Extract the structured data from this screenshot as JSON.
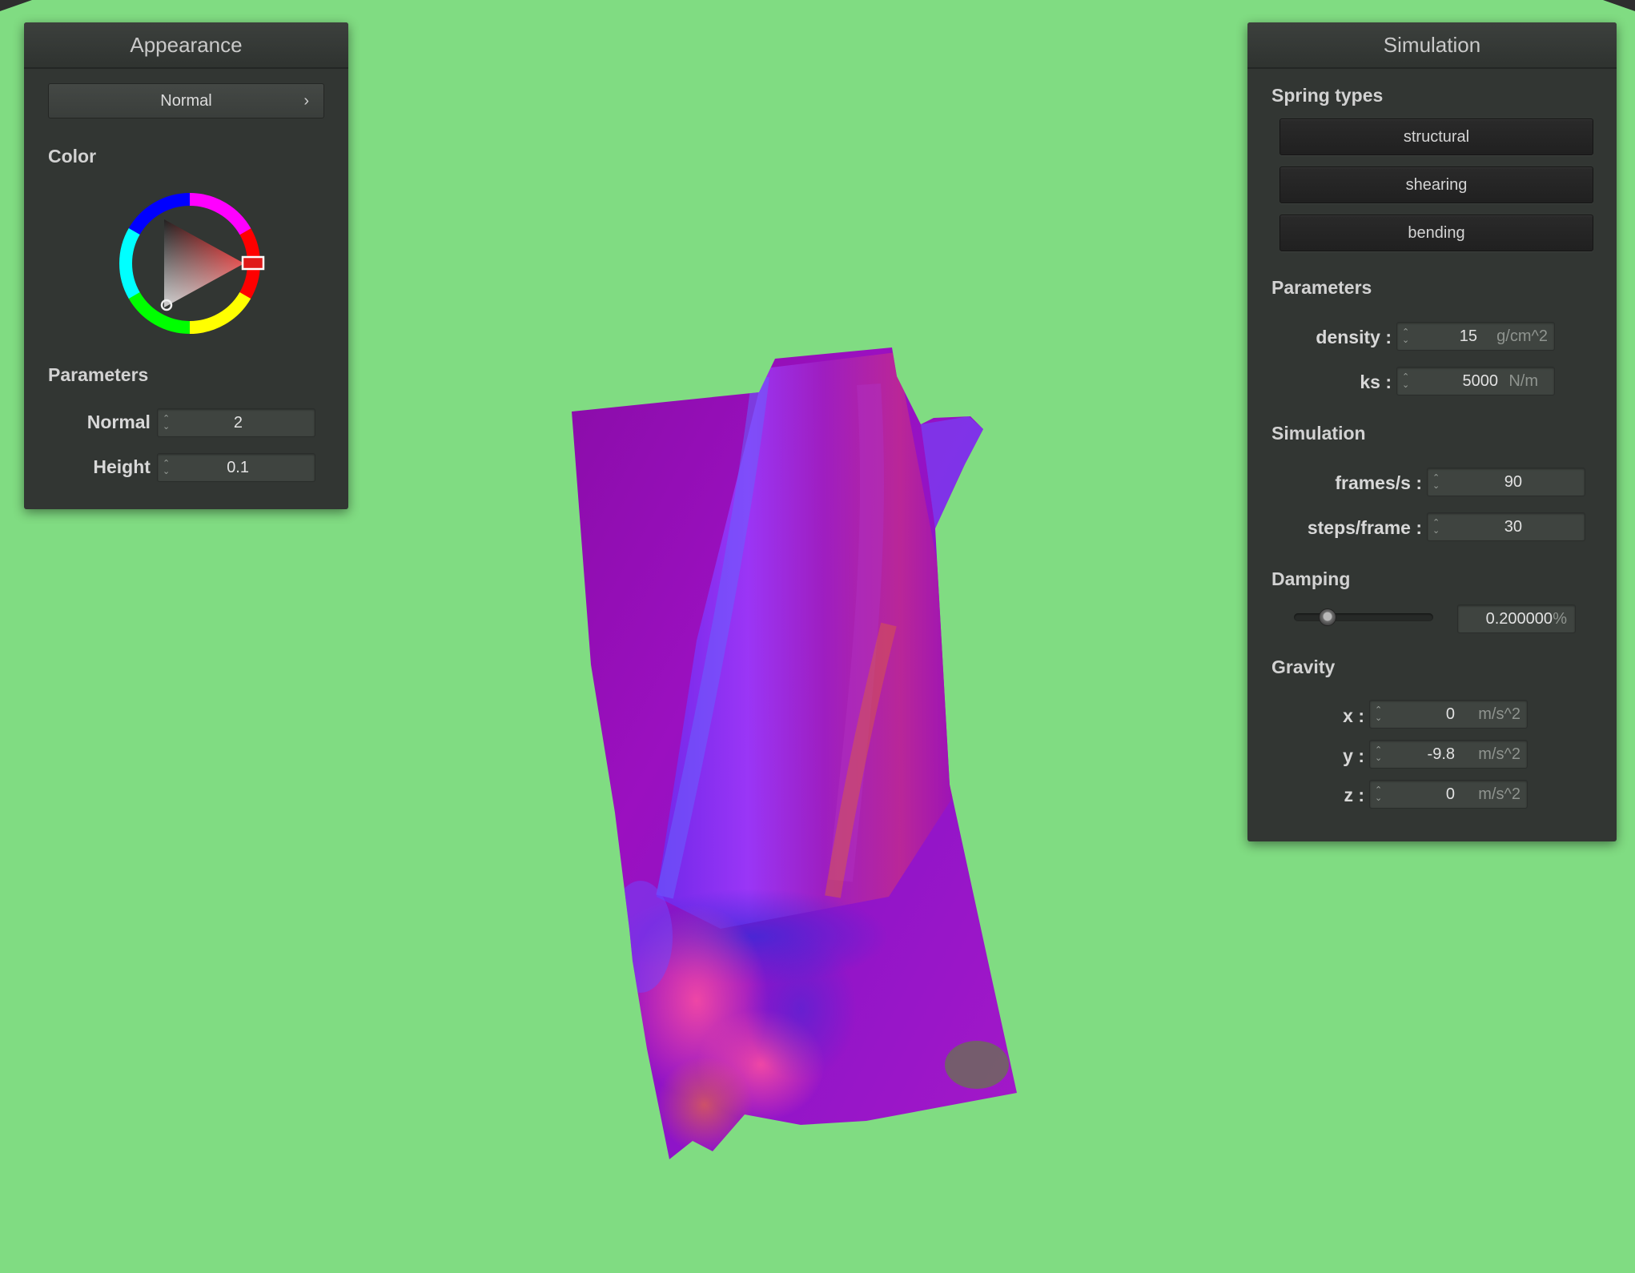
{
  "appearance": {
    "title": "Appearance",
    "mode": "Normal",
    "color_label": "Color",
    "color_value": "#e02020",
    "params_label": "Parameters",
    "normal_label": "Normal :",
    "normal_value": "2",
    "height_label": "Height :",
    "height_value": "0.1"
  },
  "simulation": {
    "title": "Simulation",
    "spring_types_label": "Spring types",
    "springs": [
      "structural",
      "shearing",
      "bending"
    ],
    "params_label": "Parameters",
    "density_label": "density :",
    "density_value": "15",
    "density_unit": "g/cm^2",
    "ks_label": "ks :",
    "ks_value": "5000",
    "ks_unit": "N/m",
    "sim_label": "Simulation",
    "fps_label": "frames/s :",
    "fps_value": "90",
    "steps_label": "steps/frame :",
    "steps_value": "30",
    "damping_label": "Damping",
    "damping_value": "0.200000",
    "damping_unit": "%",
    "damping_fraction": 0.2,
    "gravity_label": "Gravity",
    "gx_label": "x :",
    "gx_value": "0",
    "gy_label": "y :",
    "gy_value": "-9.8",
    "gz_label": "z :",
    "gz_value": "0",
    "g_unit": "m/s^2"
  },
  "colors": {
    "background": "#80dc82",
    "panel": "#323633",
    "cloth_base": "#9a10b8"
  }
}
